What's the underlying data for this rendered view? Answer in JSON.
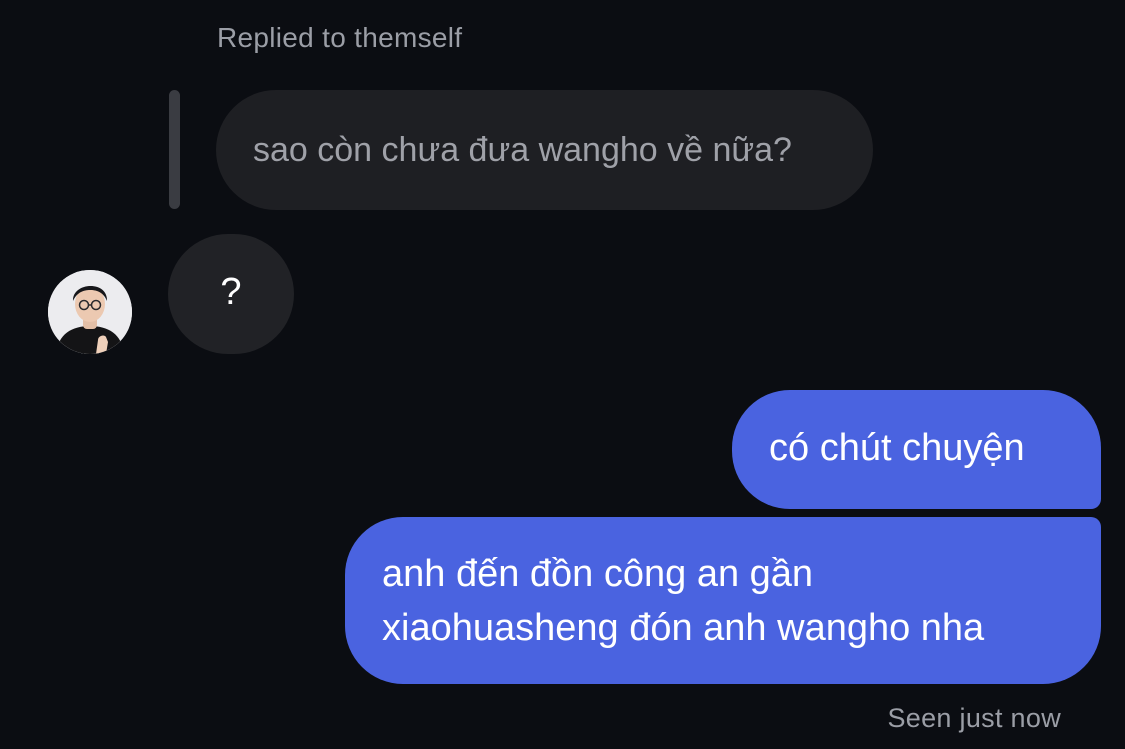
{
  "thread": {
    "reply_label": "Replied to themself",
    "quoted_message": "sao còn chưa đưa wangho về nữa?",
    "their_message": "?",
    "my_messages": [
      {
        "lines": [
          "có chút chuyện"
        ]
      },
      {
        "lines": [
          "anh đến đồn công an gần",
          "xiaohuasheng đón anh wangho nha"
        ]
      }
    ],
    "seen_status": "Seen just now"
  },
  "colors": {
    "background": "#0b0d12",
    "quoted_bubble": "#1e1f23",
    "their_bubble": "#212226",
    "my_bubble": "#4a63e0",
    "muted_text": "#9b9ea6"
  },
  "icons": {
    "avatar": "profile-photo"
  }
}
